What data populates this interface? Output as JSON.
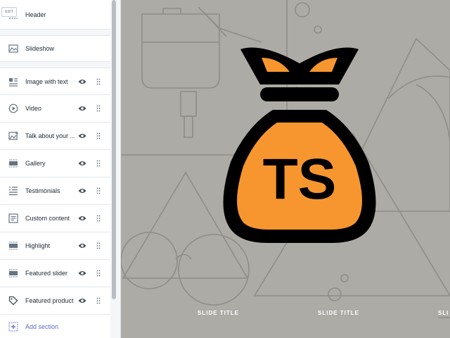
{
  "sidebar": {
    "edit_tag": "EDIT",
    "sections": [
      {
        "label": "Header",
        "icon": "header-icon"
      },
      {
        "label": "Slideshow",
        "icon": "slideshow-icon"
      },
      {
        "label": "Image with text",
        "icon": "image-with-text-icon"
      },
      {
        "label": "Video",
        "icon": "video-icon"
      },
      {
        "label": "Talk about your ...",
        "icon": "image-icon"
      },
      {
        "label": "Gallery",
        "icon": "gallery-icon"
      },
      {
        "label": "Testimonials",
        "icon": "testimonials-icon"
      },
      {
        "label": "Custom content",
        "icon": "custom-content-icon"
      },
      {
        "label": "Highlight",
        "icon": "highlight-icon"
      },
      {
        "label": "Featured slider",
        "icon": "featured-slider-icon"
      },
      {
        "label": "Featured product",
        "icon": "tag-icon"
      }
    ],
    "add_section": "Add section"
  },
  "preview": {
    "slide_titles": [
      "SLIDE TITLE",
      "SLIDE TITLE",
      "SLI"
    ],
    "logo_text": "TS",
    "logo_color": "#f7962f",
    "background_color": "#adaba6",
    "accent_color": "#5c6ac4"
  }
}
